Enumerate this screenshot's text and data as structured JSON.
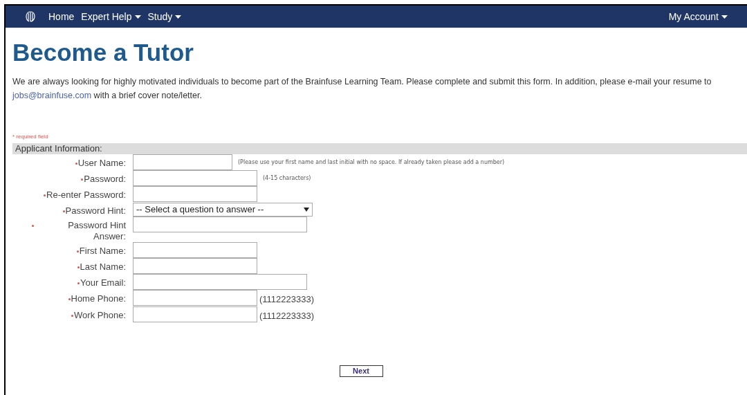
{
  "nav": {
    "items": [
      {
        "label": "Home",
        "dropdown": false
      },
      {
        "label": "Expert Help",
        "dropdown": true
      },
      {
        "label": "Study",
        "dropdown": true
      }
    ],
    "account": {
      "label": "My Account",
      "dropdown": true
    }
  },
  "title": "Become a Tutor",
  "intro": {
    "before": "We are always looking for highly motivated individuals to become part of the Brainfuse Learning Team. Please complete and submit this form. In addition, please e-mail your resume to ",
    "link": "jobs@brainfuse.com",
    "after": " with a brief cover note/letter."
  },
  "required_note": "* required field",
  "section": {
    "title": "Applicant Information:",
    "fields": [
      {
        "label": "User Name:",
        "required": true,
        "kind": "short",
        "hint": {
          "kind": "note",
          "text": "(Please use your first name and last initial with no space. If already taken please add a number)"
        }
      },
      {
        "label": "Password:",
        "required": true,
        "kind": "medium",
        "hint": {
          "kind": "note",
          "text": "(4-15 characters)"
        }
      },
      {
        "label": "Re-enter Password:",
        "required": true,
        "kind": "medium"
      },
      {
        "label": "Password Hint:",
        "required": true,
        "kind": "select",
        "value": "-- Select a question to answer --"
      },
      {
        "label": "Password Hint Answer:",
        "required": true,
        "kind": "wide"
      },
      {
        "label": "First Name:",
        "required": true,
        "kind": "medium"
      },
      {
        "label": "Last Name:",
        "required": true,
        "kind": "medium"
      },
      {
        "label": "Your Email:",
        "required": true,
        "kind": "wide"
      },
      {
        "label": "Home Phone:",
        "required": true,
        "kind": "medium",
        "hint": {
          "kind": "format",
          "text": "(1112223333)"
        }
      },
      {
        "label": "Work Phone:",
        "required": true,
        "kind": "medium",
        "hint": {
          "kind": "format",
          "text": "(1112223333)"
        }
      }
    ]
  },
  "next_button": "Next"
}
